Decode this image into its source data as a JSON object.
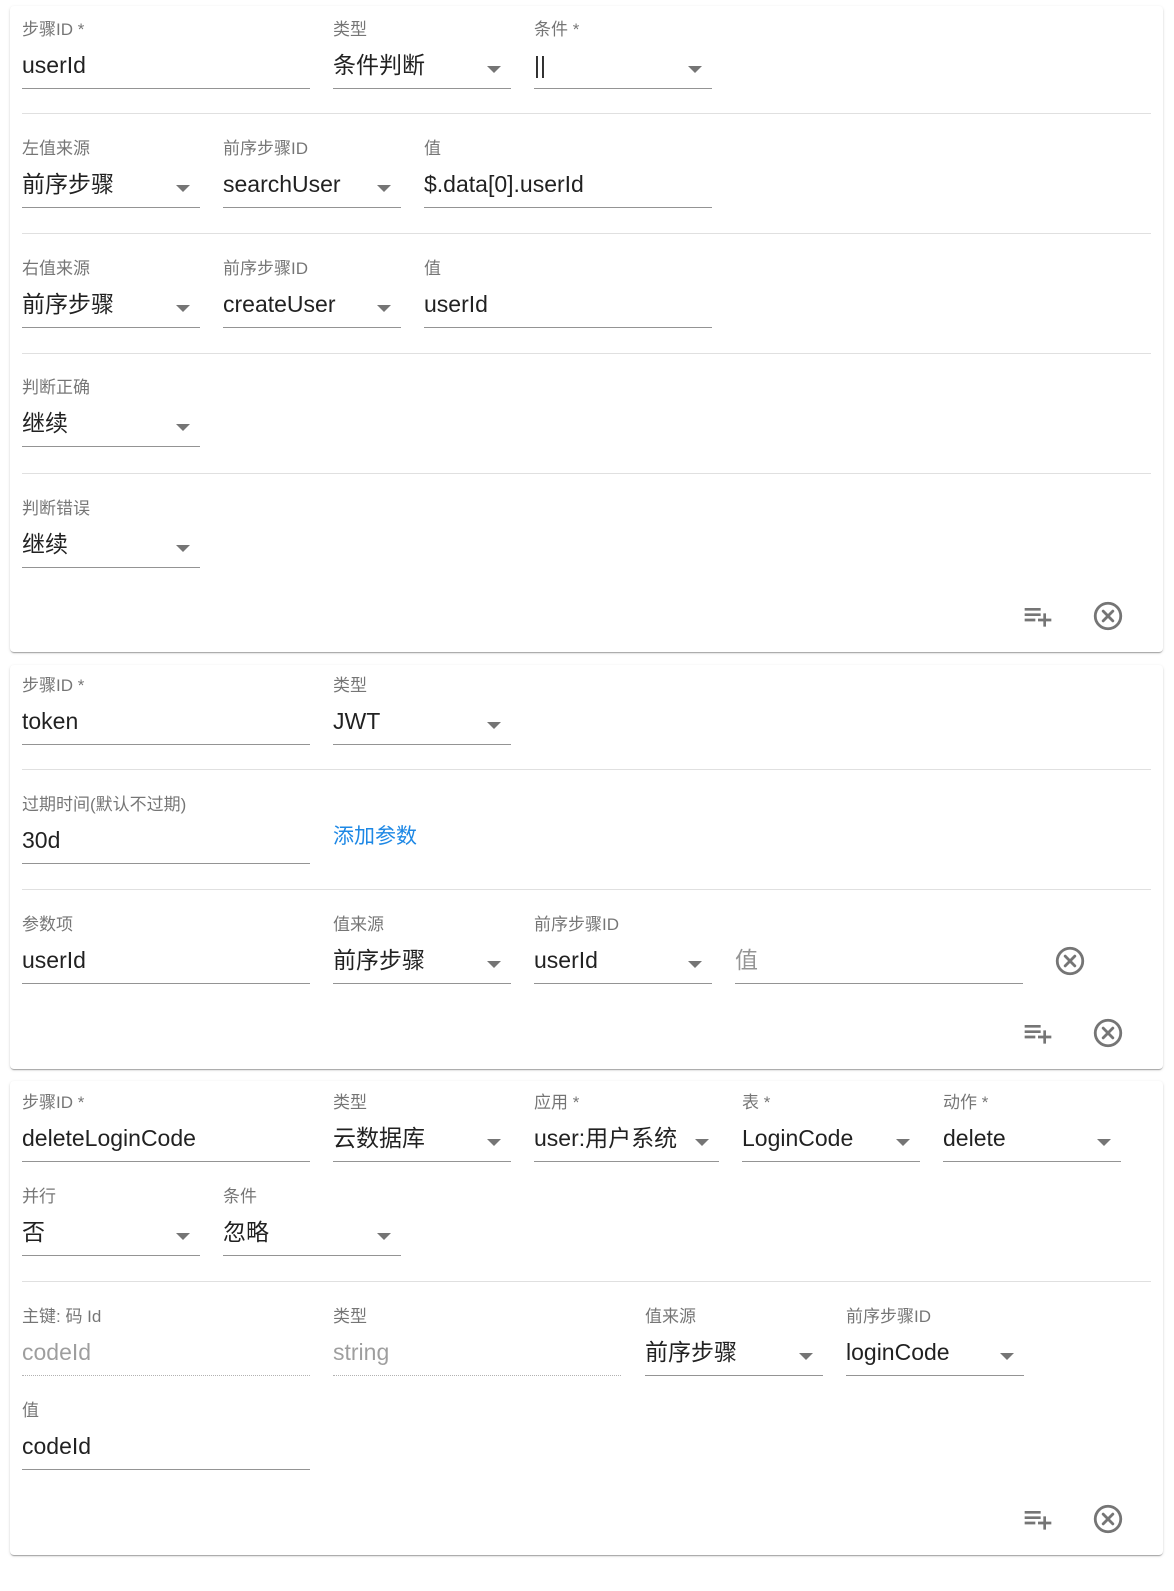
{
  "step1": {
    "step_id_label": "步骤ID *",
    "step_id_value": "userId",
    "type_label": "类型",
    "type_value": "条件判断",
    "condition_label": "条件 *",
    "condition_value": "||",
    "left_source_label": "左值来源",
    "left_source_value": "前序步骤",
    "left_prev_label": "前序步骤ID",
    "left_prev_value": "searchUser",
    "left_value_label": "值",
    "left_value": "$.data[0].userId",
    "right_source_label": "右值来源",
    "right_source_value": "前序步骤",
    "right_prev_label": "前序步骤ID",
    "right_prev_value": "createUser",
    "right_value_label": "值",
    "right_value": "userId",
    "on_true_label": "判断正确",
    "on_true_value": "继续",
    "on_false_label": "判断错误",
    "on_false_value": "继续"
  },
  "step2": {
    "step_id_label": "步骤ID *",
    "step_id_value": "token",
    "type_label": "类型",
    "type_value": "JWT",
    "expire_label": "过期时间(默认不过期)",
    "expire_value": "30d",
    "add_param_label": "添加参数",
    "param_key_label": "参数项",
    "param_key_value": "userId",
    "param_source_label": "值来源",
    "param_source_value": "前序步骤",
    "param_prev_label": "前序步骤ID",
    "param_prev_value": "userId",
    "param_value_placeholder": "值"
  },
  "step3": {
    "step_id_label": "步骤ID *",
    "step_id_value": "deleteLoginCode",
    "type_label": "类型",
    "type_value": "云数据库",
    "app_label": "应用 *",
    "app_value": "user:用户系统",
    "table_label": "表 *",
    "table_value": "LoginCode",
    "action_label": "动作 *",
    "action_value": "delete",
    "parallel_label": "并行",
    "parallel_value": "否",
    "condition_label": "条件",
    "condition_value": "忽略",
    "pk_label": "主键: 码 Id",
    "pk_value": "codeId",
    "pk_type_label": "类型",
    "pk_type_value": "string",
    "pk_source_label": "值来源",
    "pk_source_value": "前序步骤",
    "pk_prev_label": "前序步骤ID",
    "pk_prev_value": "loginCode",
    "pk_value_label": "值",
    "pk_value_value": "codeId"
  },
  "icons": {
    "add": "playlist-add-icon",
    "remove": "close-circle-icon"
  },
  "colors": {
    "link": "#1e88e5",
    "text": "#212121",
    "label": "#757575",
    "icon": "#757575"
  }
}
